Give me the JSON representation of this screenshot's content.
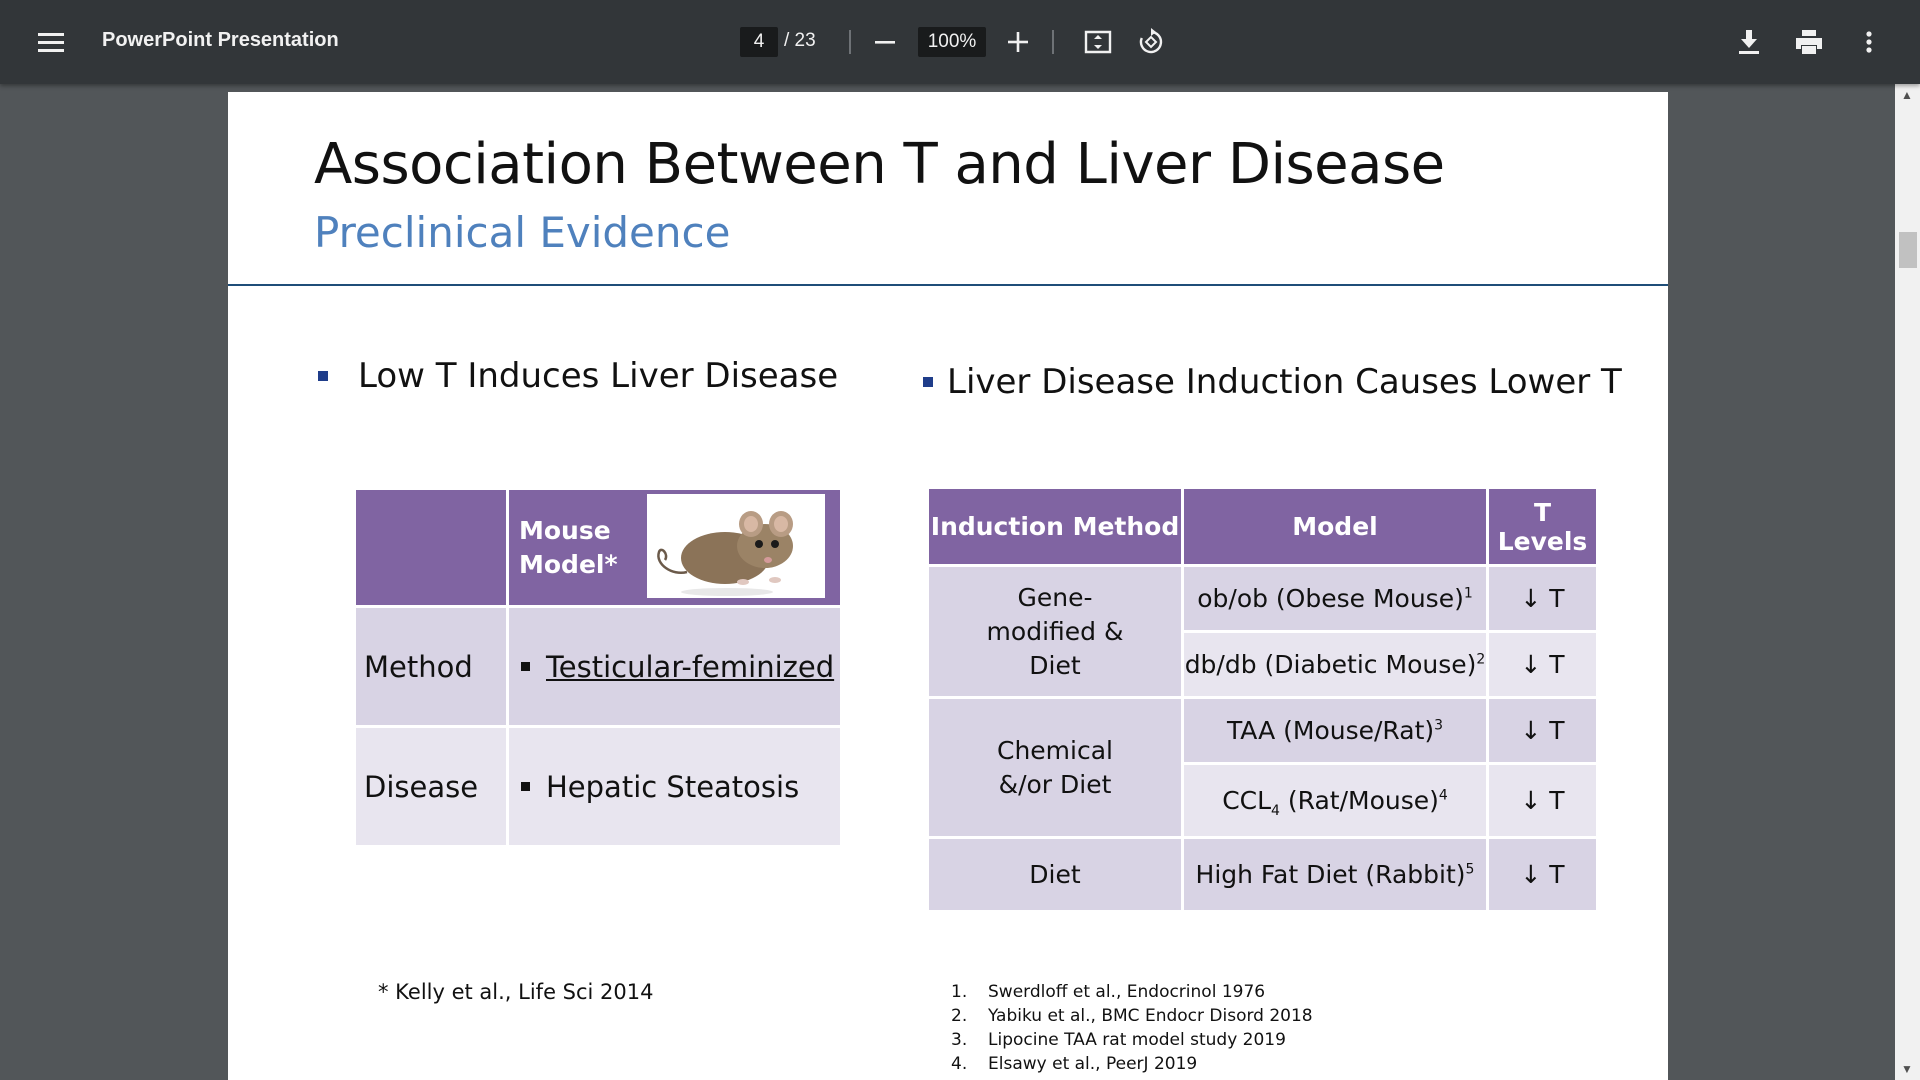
{
  "toolbar": {
    "menu_icon": "hamburger-menu-icon",
    "title": "PowerPoint Presentation",
    "current_page": "4",
    "total_pages": "/ 23",
    "zoom_value": "100%",
    "icons": [
      "zoom-out-icon",
      "zoom-in-icon",
      "fit-page-icon",
      "rotate-icon",
      "download-icon",
      "print-icon",
      "more-vert-icon"
    ]
  },
  "slide": {
    "title": "Association Between T and Liver Disease",
    "subtitle": "Preclinical Evidence",
    "left_heading": "Low T Induces Liver Disease",
    "right_heading": "Liver Disease Induction Causes Lower T",
    "left_table": {
      "header_label": "Mouse Model*",
      "header_image": "mouse-photo",
      "rows": [
        {
          "label": "Method",
          "value": "Testicular-feminized"
        },
        {
          "label": "Disease",
          "value": "Hepatic Steatosis"
        }
      ]
    },
    "right_table": {
      "headers": [
        "Induction Method",
        "Model",
        "T Levels"
      ],
      "groups": [
        {
          "method": "Gene-modified & Diet",
          "models": [
            {
              "name": "ob/ob (Obese Mouse)",
              "sup": "1",
              "t": "↓ T"
            },
            {
              "name": "db/db (Diabetic Mouse)",
              "sup": "2",
              "t": "↓ T"
            }
          ]
        },
        {
          "method": "Chemical &/or Diet",
          "models": [
            {
              "name": "TAA (Mouse/Rat)",
              "sup": "3",
              "t": "↓ T"
            },
            {
              "name_pre": "CCL",
              "sub": "4",
              "name_post": " (Rat/Mouse)",
              "sup": "4",
              "t": "↓ T"
            }
          ]
        },
        {
          "method": "Diet",
          "models": [
            {
              "name": "High Fat Diet (Rabbit)",
              "sup": "5",
              "t": "↓ T"
            }
          ]
        }
      ]
    },
    "footnote_left": "* Kelly et al., Life Sci 2014",
    "references": [
      {
        "num": "1.",
        "text": "Swerdloff et al., Endocrinol 1976"
      },
      {
        "num": "2.",
        "text": "Yabiku et al., BMC Endocr Disord 2018"
      },
      {
        "num": "3.",
        "text": "Lipocine TAA rat model study 2019"
      },
      {
        "num": "4.",
        "text": "Elsawy et al., PeerJ 2019"
      }
    ]
  }
}
